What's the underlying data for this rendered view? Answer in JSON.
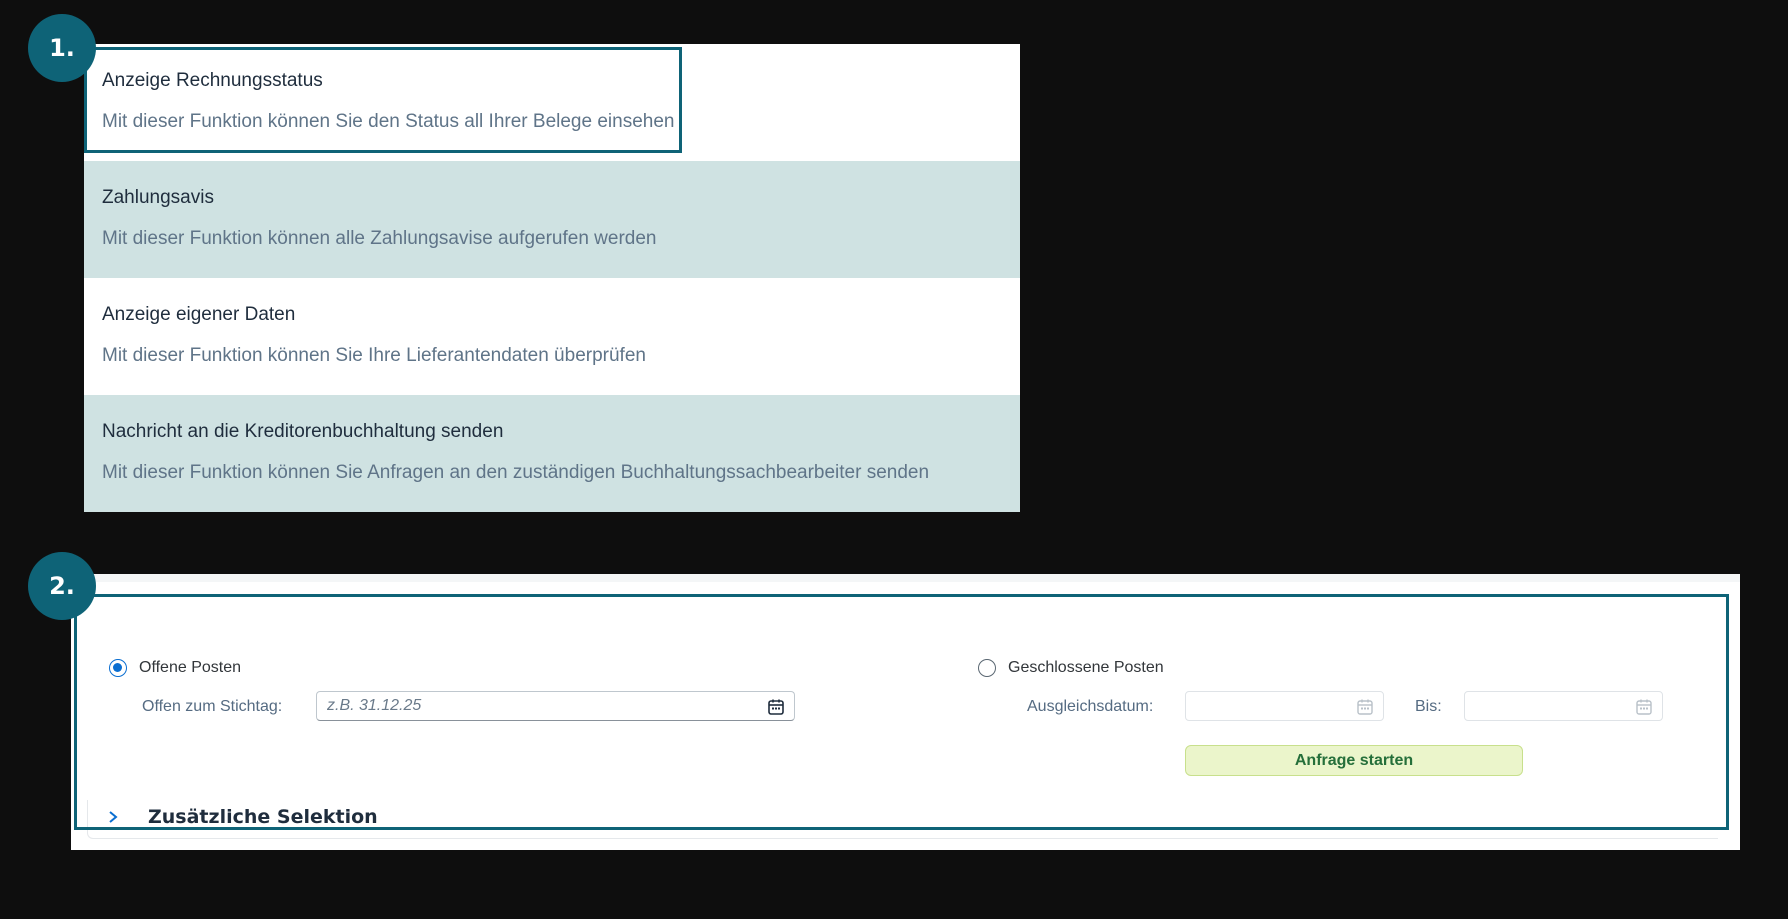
{
  "badges": {
    "step1": "1.",
    "step2": "2."
  },
  "panel1": {
    "tiles": [
      {
        "title": "Anzeige Rechnungsstatus",
        "description": "Mit dieser Funktion können Sie den Status all Ihrer Belege einsehen"
      },
      {
        "title": "Zahlungsavis",
        "description": "Mit dieser Funktion können alle Zahlungsavise aufgerufen werden"
      },
      {
        "title": "Anzeige eigener Daten",
        "description": "Mit dieser Funktion können Sie Ihre Lieferantendaten überprüfen"
      },
      {
        "title": "Nachricht an die Kreditorenbuchhaltung senden",
        "description": "Mit dieser Funktion können Sie Anfragen an den zuständigen Buchhaltungssachbearbeiter senden"
      }
    ]
  },
  "panel2": {
    "open_items": {
      "label": "Offene Posten",
      "selected": true,
      "date_label": "Offen zum Stichtag:",
      "date_placeholder": "z.B. 31.12.25"
    },
    "closed_items": {
      "label": "Geschlossene Posten",
      "selected": false,
      "clearing_label": "Ausgleichsdatum:",
      "to_label": "Bis:"
    },
    "start_button": "Anfrage starten",
    "additional_selection": "Zusätzliche Selektion"
  },
  "colors": {
    "accent": "#0e6377",
    "tile_tint": "#cfe2e2",
    "radio_selected": "#0a6ed1",
    "button_bg": "#ebf5cb",
    "button_text": "#256f3a"
  },
  "icons": {
    "date_picker": "calendar-icon",
    "expand": "chevron-right-icon"
  }
}
